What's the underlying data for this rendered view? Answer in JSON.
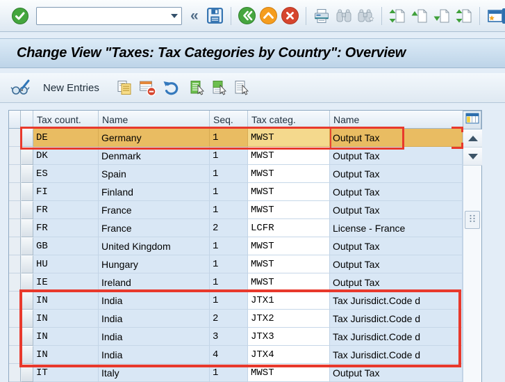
{
  "standard_toolbar": {
    "command_field_value": "",
    "collapse_glyph": "«",
    "icons": [
      "enter-icon",
      "command-field-dropdown-icon",
      "collapse-icon",
      "save-icon",
      "back-icon",
      "exit-icon",
      "cancel-icon",
      "print-icon",
      "find-icon",
      "find-next-icon",
      "scroll-first-icon",
      "scroll-prev-icon",
      "scroll-next-icon",
      "scroll-last-icon",
      "new-session-icon",
      "clipped-icon"
    ]
  },
  "title_bar": {
    "title": "Change View \"Taxes: Tax Categories by Country\": Overview"
  },
  "application_toolbar": {
    "new_entries_label": "New Entries",
    "icons": [
      "display-change-icon",
      "copy-icon",
      "delete-row-icon",
      "undo-icon",
      "select-all-icon",
      "select-block-icon",
      "deselect-all-icon"
    ]
  },
  "table": {
    "columns": [
      "Tax count.",
      "Name",
      "Seq.",
      "Tax categ.",
      "Name"
    ],
    "rows": [
      {
        "country": "DE",
        "name": "Germany",
        "seq": "1",
        "category": "MWST",
        "category_name": "Output Tax",
        "selected": true
      },
      {
        "country": "DK",
        "name": "Denmark",
        "seq": "1",
        "category": "MWST",
        "category_name": "Output Tax",
        "selected": false
      },
      {
        "country": "ES",
        "name": "Spain",
        "seq": "1",
        "category": "MWST",
        "category_name": "Output Tax",
        "selected": false
      },
      {
        "country": "FI",
        "name": "Finland",
        "seq": "1",
        "category": "MWST",
        "category_name": "Output Tax",
        "selected": false
      },
      {
        "country": "FR",
        "name": "France",
        "seq": "1",
        "category": "MWST",
        "category_name": "Output Tax",
        "selected": false
      },
      {
        "country": "FR",
        "name": "France",
        "seq": "2",
        "category": "LCFR",
        "category_name": "License - France",
        "selected": false
      },
      {
        "country": "GB",
        "name": "United Kingdom",
        "seq": "1",
        "category": "MWST",
        "category_name": "Output Tax",
        "selected": false
      },
      {
        "country": "HU",
        "name": "Hungary",
        "seq": "1",
        "category": "MWST",
        "category_name": "Output Tax",
        "selected": false
      },
      {
        "country": "IE",
        "name": "Ireland",
        "seq": "1",
        "category": "MWST",
        "category_name": "Output Tax",
        "selected": false
      },
      {
        "country": "IN",
        "name": "India",
        "seq": "1",
        "category": "JTX1",
        "category_name": "Tax Jurisdict.Code d",
        "selected": false
      },
      {
        "country": "IN",
        "name": "India",
        "seq": "2",
        "category": "JTX2",
        "category_name": "Tax Jurisdict.Code d",
        "selected": false
      },
      {
        "country": "IN",
        "name": "India",
        "seq": "3",
        "category": "JTX3",
        "category_name": "Tax Jurisdict.Code d",
        "selected": false
      },
      {
        "country": "IN",
        "name": "India",
        "seq": "4",
        "category": "JTX4",
        "category_name": "Tax Jurisdict.Code d",
        "selected": false
      },
      {
        "country": "IT",
        "name": "Italy",
        "seq": "1",
        "category": "MWST",
        "category_name": "Output Tax",
        "selected": false
      }
    ]
  },
  "colors": {
    "selected_row": "#e9bc62",
    "selected_row_input_cell": "#f4d98d",
    "row_background": "#d9e7f5",
    "annotation_red": "#e8392c",
    "page_background": "#e3edf7"
  }
}
